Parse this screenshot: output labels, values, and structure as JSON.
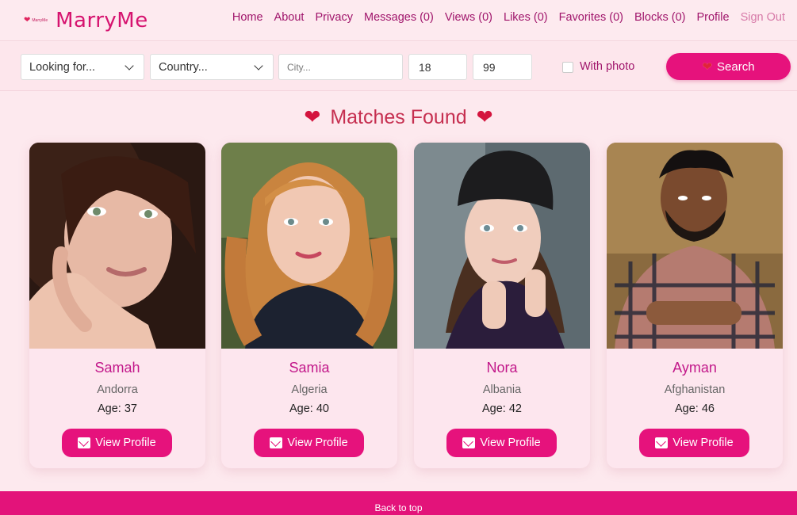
{
  "brand": {
    "mini_label": "MarryMe",
    "name": "MarryMe",
    "accent": "#e6127c"
  },
  "nav": [
    {
      "label": "Home"
    },
    {
      "label": "About"
    },
    {
      "label": "Privacy"
    },
    {
      "label": "Messages (0)"
    },
    {
      "label": "Views (0)"
    },
    {
      "label": "Likes (0)"
    },
    {
      "label": "Favorites (0)"
    },
    {
      "label": "Blocks (0)"
    },
    {
      "label": "Profile"
    },
    {
      "label": "Sign Out"
    }
  ],
  "search": {
    "looking_for": "Looking for...",
    "country": "Country...",
    "city_placeholder": "City...",
    "age_min": "18",
    "age_max": "99",
    "with_photo_label": "With photo",
    "button_label": "Search"
  },
  "results": {
    "title": "Matches Found",
    "cards": [
      {
        "name": "Samah",
        "country": "Andorra",
        "age_label": "Age: 37",
        "button_label": "View Profile"
      },
      {
        "name": "Samia",
        "country": "Algeria",
        "age_label": "Age: 40",
        "button_label": "View Profile"
      },
      {
        "name": "Nora",
        "country": "Albania",
        "age_label": "Age: 42",
        "button_label": "View Profile"
      },
      {
        "name": "Ayman",
        "country": "Afghanistan",
        "age_label": "Age: 46",
        "button_label": "View Profile"
      }
    ]
  },
  "footer": {
    "back_to_top": "Back to top"
  }
}
